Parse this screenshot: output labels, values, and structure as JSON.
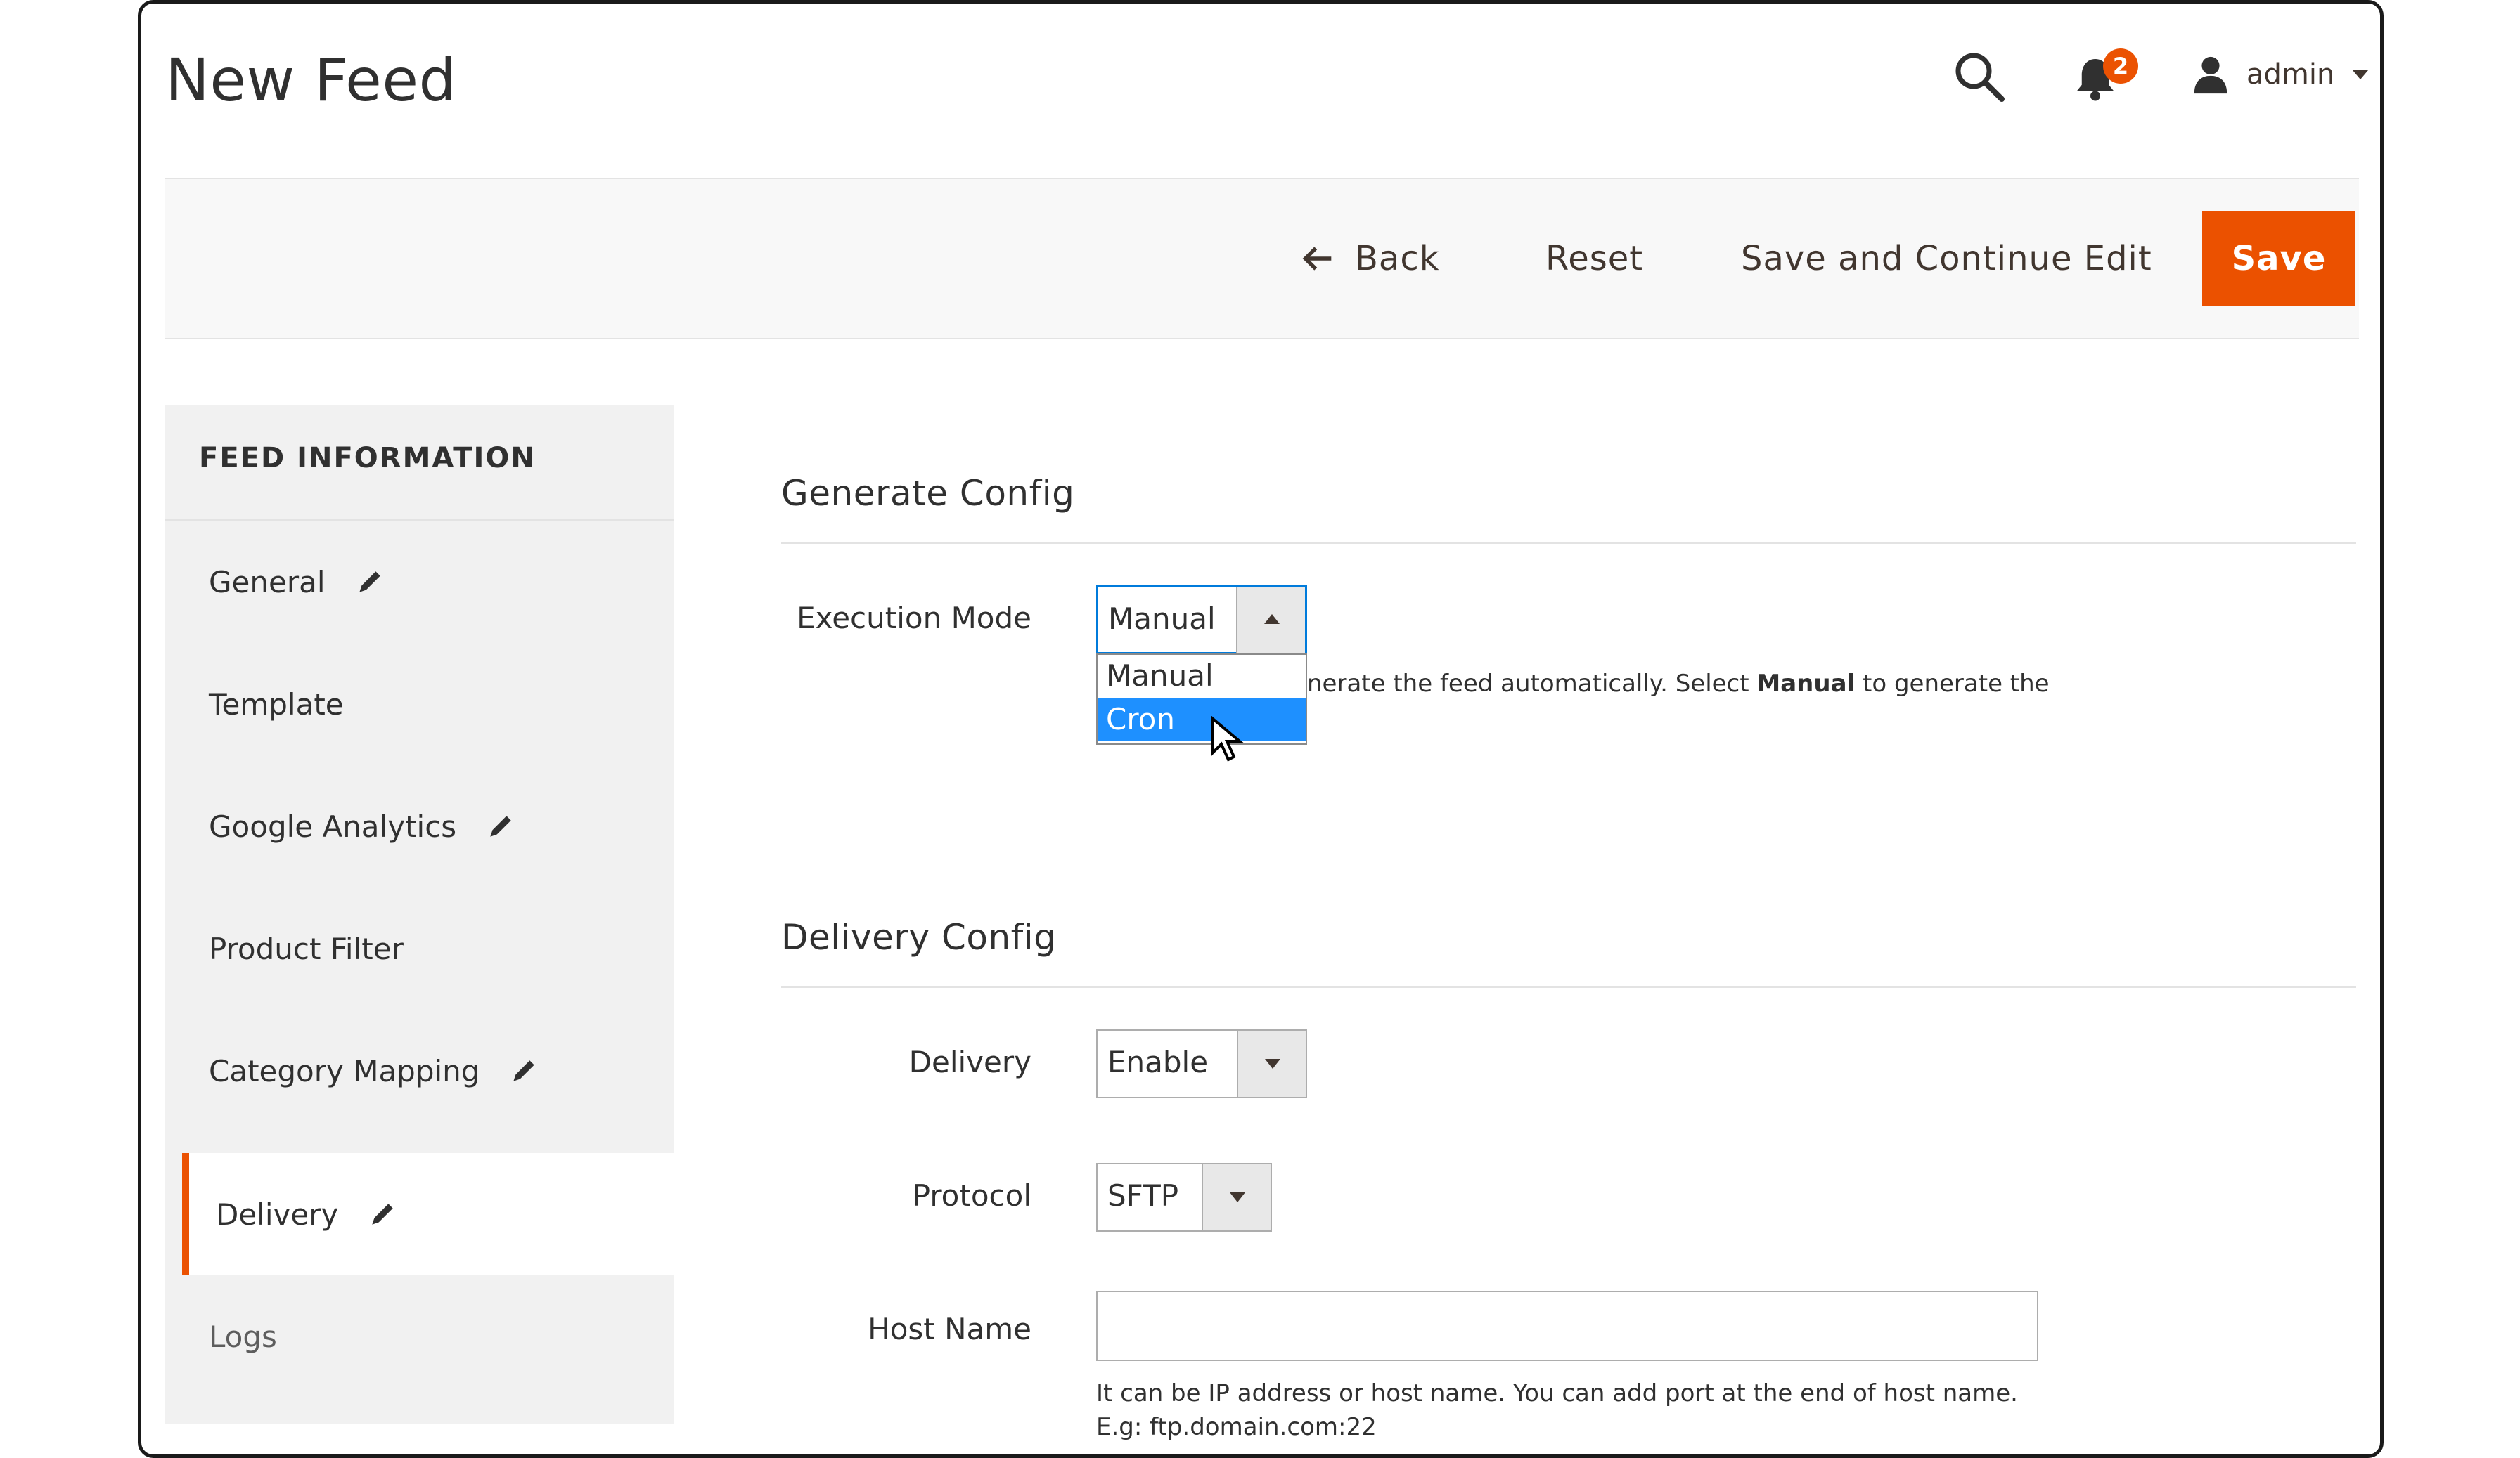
{
  "header": {
    "title": "New Feed",
    "notification_count": "2",
    "user_name": "admin"
  },
  "actions": {
    "back_label": "Back",
    "reset_label": "Reset",
    "save_continue_label": "Save and Continue Edit",
    "save_label": "Save"
  },
  "sidebar": {
    "heading": "FEED INFORMATION",
    "items": [
      {
        "label": "General",
        "edited": true
      },
      {
        "label": "Template",
        "edited": false
      },
      {
        "label": "Google Analytics",
        "edited": true
      },
      {
        "label": "Product Filter",
        "edited": false
      },
      {
        "label": "Category Mapping",
        "edited": true
      },
      {
        "label": "Delivery",
        "edited": true,
        "active": true
      },
      {
        "label": "Logs",
        "edited": false
      }
    ]
  },
  "generate_config": {
    "title": "Generate Config",
    "execution_mode_label": "Execution Mode",
    "execution_mode_value": "Manual",
    "options": [
      "Manual",
      "Cron"
    ],
    "highlighted_option": "Cron",
    "note_visible": "nerate the feed automatically. Select ",
    "note_bold": "Manual",
    "note_tail": " to generate the"
  },
  "delivery_config": {
    "title": "Delivery Config",
    "delivery_label": "Delivery",
    "delivery_value": "Enable",
    "protocol_label": "Protocol",
    "protocol_value": "SFTP",
    "host_label": "Host Name",
    "host_value": "",
    "host_hint_line1": "It can be IP address or host name. You can add port at the end of host name.",
    "host_hint_line2": "E.g: ftp.domain.com:22"
  },
  "colors": {
    "accent": "#eb5202",
    "focus_border": "#007bdb",
    "option_highlight": "#1e90ff"
  }
}
